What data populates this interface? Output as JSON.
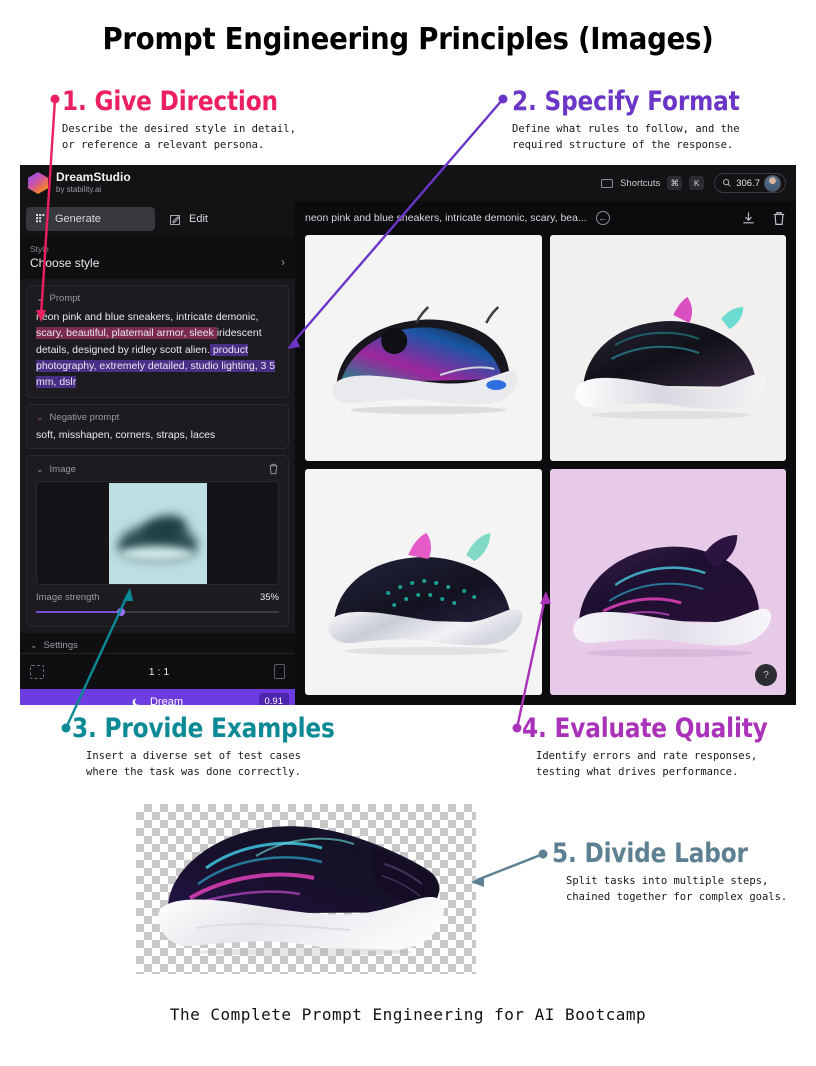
{
  "title": "Prompt Engineering Principles (Images)",
  "footer": "The Complete Prompt Engineering for AI Bootcamp",
  "colors": {
    "pink": "#EC1F60",
    "purple": "#6B35C8",
    "teal": "#0B8A96",
    "magenta": "#AA32B8",
    "slate": "#5D7F92",
    "dream_button": "#6C3CE0"
  },
  "callouts": [
    {
      "number": "1.",
      "heading": "1. Give Direction",
      "description": "Describe the desired style in detail,\nor reference a relevant persona.",
      "color": "#EC1F60"
    },
    {
      "number": "2.",
      "heading": "2. Specify Format",
      "description": "Define what rules to follow, and the\nrequired structure of the response.",
      "color": "#6B35C8"
    },
    {
      "number": "3.",
      "heading": "3. Provide Examples",
      "description": "Insert a diverse set of test cases\nwhere the task was done correctly.",
      "color": "#0B8A96"
    },
    {
      "number": "4.",
      "heading": "4. Evaluate Quality",
      "description": "Identify errors and rate responses,\ntesting what drives performance.",
      "color": "#AA32B8"
    },
    {
      "number": "5.",
      "heading": "5. Divide Labor",
      "description": "Split tasks into multiple steps,\nchained together for complex goals.",
      "color": "#5D7F92"
    }
  ],
  "app": {
    "brand": {
      "name": "DreamStudio",
      "subtitle": "by stability.ai",
      "logo_icon": "stability-diamond-logo"
    },
    "header": {
      "shortcuts_label": "Shortcuts",
      "shortcuts_icon": "keyboard-icon",
      "key_modifier": "⌘",
      "key_letter": "K",
      "credits_icon": "credits-coin-icon",
      "credits_value": "306.7",
      "avatar_name": "user-avatar"
    },
    "tabs": [
      {
        "label": "Generate",
        "icon": "grid-dots-icon",
        "active": true
      },
      {
        "label": "Edit",
        "icon": "pencil-square-icon",
        "active": false
      }
    ],
    "style_panel": {
      "label": "Style",
      "value": "Choose style",
      "chevron_icon": "chevron-right-icon"
    },
    "prompt_panel": {
      "label": "Prompt",
      "caret_icon": "chevron-down-icon",
      "segments": [
        {
          "text": "neon pink and blue sneakers, intricate demonic, ",
          "highlight": "none"
        },
        {
          "text": "scary, beautiful, platemail armor, sleek ",
          "highlight": "pink"
        },
        {
          "text": "iridescent details, designed by ridley scott alien.",
          "highlight": "pink"
        },
        {
          "text": " product photography, extremely detailed, studio lighting, 3 5 mm, dslr",
          "highlight": "purple"
        }
      ],
      "full_text": "neon pink and blue sneakers, intricate demonic, scary, beautiful, platemail armor, sleek iridescent details, designed by ridley scott alien. product photography, extremely detailed, studio lighting, 3 5 mm, dslr"
    },
    "negative_panel": {
      "label": "Negative prompt",
      "caret_icon": "chevron-down-icon",
      "value": "soft, misshapen, corners, straps, laces"
    },
    "image_panel": {
      "label": "Image",
      "caret_icon": "chevron-down-icon",
      "delete_icon": "trash-icon",
      "reference_image_name": "reference-sneaker-sketch",
      "strength_label": "Image strength",
      "strength_value": "35%",
      "strength_percent": 35
    },
    "settings_panel": {
      "label": "Settings",
      "caret_icon": "chevron-down-icon",
      "aspect_ratio": "1 : 1",
      "left_icon": "crop-square-icon",
      "right_icon": "portrait-icon"
    },
    "dream_button": {
      "label": "Dream",
      "icon": "moon-icon",
      "cost": "0.91"
    },
    "canvas": {
      "prompt_summary": "neon pink and blue sneakers, intricate demonic, scary, bea...",
      "history_icon": "history-back-icon",
      "download_icon": "download-icon",
      "delete_icon": "trash-icon",
      "help_label": "?",
      "results": [
        {
          "name": "result-image-1",
          "background": "#f4f4f3"
        },
        {
          "name": "result-image-2",
          "background": "#f1f0ef"
        },
        {
          "name": "result-image-3",
          "background": "#f4f4f4"
        },
        {
          "name": "result-image-4",
          "background": "#e7c9e8"
        }
      ]
    }
  },
  "bottom_image": {
    "name": "transparent-background-sneaker",
    "has_checkerboard": true
  }
}
